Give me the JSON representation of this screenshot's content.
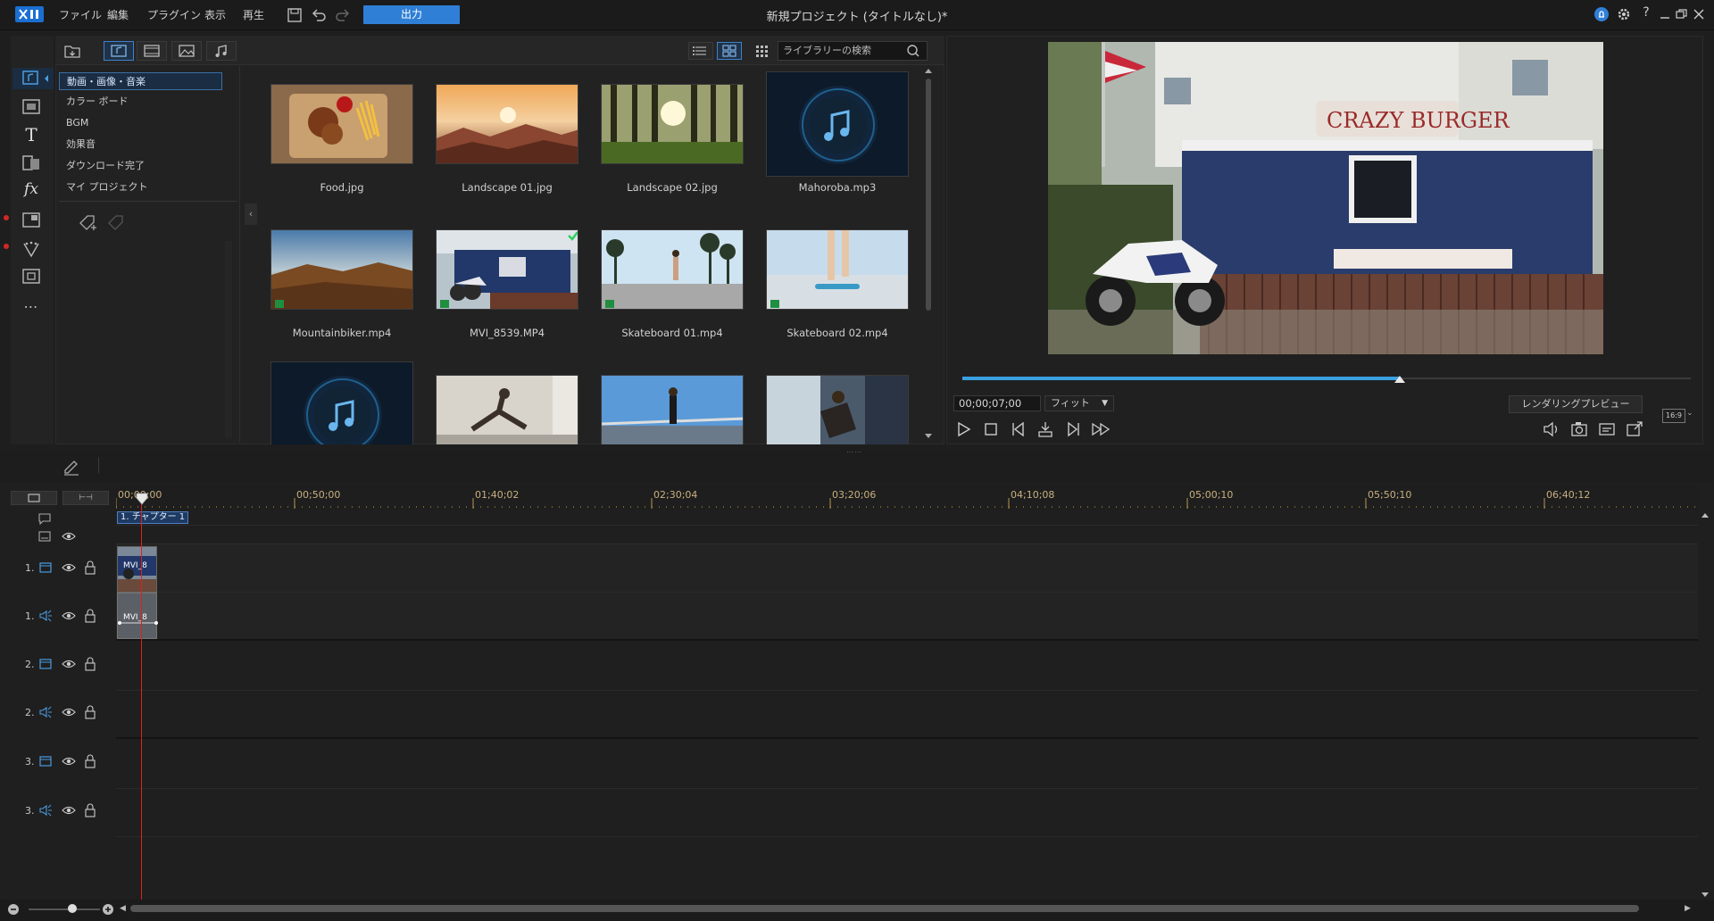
{
  "titlebar": {
    "menus": [
      "ファイル",
      "編集",
      "プラグイン",
      "表示",
      "再生"
    ],
    "output_label": "出力",
    "window_title": "新規プロジェクト (タイトルなし)*"
  },
  "library": {
    "categories": [
      "動画・画像・音楽",
      "カラー ボード",
      "BGM",
      "効果音",
      "ダウンロード完了",
      "マイ プロジェクト"
    ],
    "search_placeholder": "ライブラリーの検索",
    "items": [
      {
        "name": "Food.jpg"
      },
      {
        "name": "Landscape 01.jpg"
      },
      {
        "name": "Landscape 02.jpg"
      },
      {
        "name": "Mahoroba.mp3"
      },
      {
        "name": "Mountainbiker.mp4"
      },
      {
        "name": "MVI_8539.MP4"
      },
      {
        "name": "Skateboard 01.mp4"
      },
      {
        "name": "Skateboard 02.mp4"
      }
    ]
  },
  "preview": {
    "timecode": "00;00;07;00",
    "fit_label": "フィット",
    "render_preview_label": "レンダリングプレビュー",
    "aspect_label": "16:9",
    "progress": 0.61
  },
  "timeline": {
    "ruler_labels": [
      "00;00;00",
      "00;50;00",
      "01;40;02",
      "02;30;04",
      "03;20;06",
      "04;10;08",
      "05;00;10",
      "05;50;10",
      "06;40;12"
    ],
    "chapter_label": "1. チャプター 1",
    "tracks": [
      {
        "num": "1.",
        "type": "video"
      },
      {
        "num": "1.",
        "type": "audio"
      },
      {
        "num": "2.",
        "type": "video"
      },
      {
        "num": "2.",
        "type": "audio"
      },
      {
        "num": "3.",
        "type": "video"
      },
      {
        "num": "3.",
        "type": "audio"
      }
    ],
    "clip_video_label": "MVI_8",
    "clip_audio_label": "MVI_8"
  },
  "colors": {
    "accent": "#2f7fd6",
    "playhead": "#e02020",
    "background": "#1e1e1e"
  }
}
